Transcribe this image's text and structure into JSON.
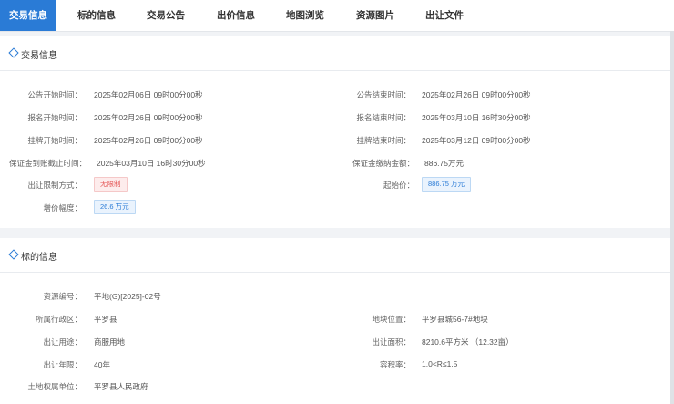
{
  "tabs": [
    {
      "label": "交易信息",
      "active": true
    },
    {
      "label": "标的信息"
    },
    {
      "label": "交易公告"
    },
    {
      "label": "出价信息"
    },
    {
      "label": "地图浏览"
    },
    {
      "label": "资源图片"
    },
    {
      "label": "出让文件"
    }
  ],
  "trade": {
    "title": "交易信息",
    "left": [
      {
        "label": "公告开始时间：",
        "value": "2025年02月06日 09时00分00秒"
      },
      {
        "label": "报名开始时间：",
        "value": "2025年02月26日 09时00分00秒"
      },
      {
        "label": "挂牌开始时间：",
        "value": "2025年02月26日 09时00分00秒"
      },
      {
        "label": "保证金到账截止时间：",
        "value": "2025年03月10日 16时30分00秒"
      },
      {
        "label": "出让限制方式：",
        "value": "无限制"
      },
      {
        "label": "增价幅度：",
        "value": "26.6 万元"
      }
    ],
    "right": [
      {
        "label": "公告结束时间：",
        "value": "2025年02月26日 09时00分00秒"
      },
      {
        "label": "报名结束时间：",
        "value": "2025年03月10日 16时30分00秒"
      },
      {
        "label": "挂牌结束时间：",
        "value": "2025年03月12日 09时00分00秒"
      },
      {
        "label": "保证金缴纳金额：",
        "value": "886.75万元"
      },
      {
        "label": "起始价：",
        "value": "886.75 万元"
      }
    ]
  },
  "subject": {
    "title": "标的信息",
    "left": [
      {
        "label": "资源编号：",
        "value": "平地(G)[2025]-02号"
      },
      {
        "label": "所属行政区：",
        "value": "平罗县"
      },
      {
        "label": "出让用途：",
        "value": "商服用地"
      },
      {
        "label": "出让年限：",
        "value": "40年"
      },
      {
        "label": "土地权属单位：",
        "value": "平罗县人民政府"
      }
    ],
    "right": [
      {
        "label": "地块位置：",
        "value": "平罗县城56-7#地块"
      },
      {
        "label": "出让面积：",
        "value": "8210.6平方米 （12.32亩）"
      },
      {
        "label": "容积率：",
        "value": "1.0<R≤1.5"
      }
    ]
  }
}
